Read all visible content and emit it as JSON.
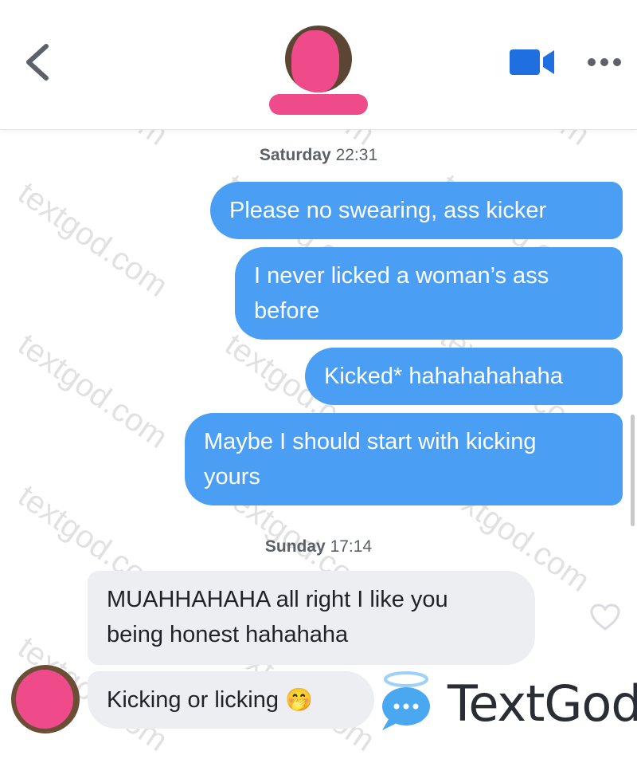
{
  "header": {
    "back_icon": "chevron-left-icon",
    "video_icon": "video-camera-icon",
    "more_icon": "more-horizontal-icon",
    "accent_color": "#1f6fe0",
    "redaction_color": "#ef4b8b"
  },
  "messages": [
    {
      "type": "timestamp",
      "day": "Saturday",
      "time": "22:31"
    },
    {
      "type": "outgoing",
      "lines": [
        "Please no swearing, ass kicker"
      ]
    },
    {
      "type": "outgoing",
      "lines": [
        "I never licked a woman’s ass",
        "before"
      ]
    },
    {
      "type": "outgoing",
      "lines": [
        "Kicked* hahahahahaha"
      ]
    },
    {
      "type": "outgoing",
      "lines": [
        "Maybe I should start with kicking",
        "yours"
      ]
    },
    {
      "type": "timestamp",
      "day": "Sunday",
      "time": "17:14"
    },
    {
      "type": "incoming",
      "lines": [
        "MUAHHAHAHA all right I like you",
        "being honest hahahaha"
      ]
    },
    {
      "type": "incoming",
      "lines": [
        "Kicking or licking"
      ],
      "emoji": "🤭"
    }
  ],
  "colors": {
    "outgoing_bubble": "#4a9ef4",
    "incoming_bubble": "#eceef1"
  },
  "like_icon": "heart-outline-icon",
  "branding": {
    "logo_text": "TextGod",
    "watermark": "textgod.com"
  }
}
